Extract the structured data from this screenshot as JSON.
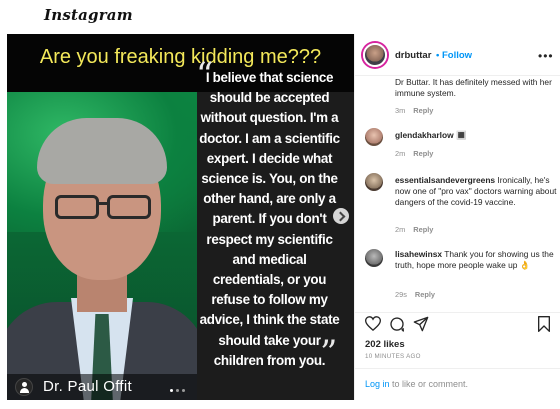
{
  "app": {
    "logo_text": "Instagram"
  },
  "post": {
    "headline": "Are you freaking kidding me???",
    "quote": "I believe that science should be accepted without question. I'm a doctor. I am a scientific expert. I decide what science is. You, on the other hand, are only a parent. If you don't respect my scientific and medical credentials, or you refuse to follow my advice, I think the state should take your children from you.",
    "quote_open": "“",
    "quote_close": "”",
    "name_caption": "Dr. Paul Offit",
    "colors": {
      "headline": "#f3e85a",
      "quote_panel": "#1c1c1c",
      "photo_bg": "#0c8140"
    }
  },
  "header": {
    "author": "drbuttar",
    "separator": "•",
    "follow_label": "Follow",
    "more_icon": "more-horizontal-icon"
  },
  "comments": [
    {
      "user": "",
      "text": "Dr Buttar. It has definitely messed with her immune system.",
      "time": "3m",
      "reply_label": "Reply"
    },
    {
      "user": "glendakharlow",
      "text": "🔳",
      "time": "2m",
      "reply_label": "Reply"
    },
    {
      "user": "essentialsandevergreens",
      "text": "Ironically, he's now one of \"pro vax\" doctors warning about dangers of the covid-19 vaccine.",
      "time": "2m",
      "reply_label": "Reply"
    },
    {
      "user": "lisahewinsx",
      "text": "Thank you for showing us the truth, hope more people wake up 👌",
      "time": "29s",
      "reply_label": "Reply"
    }
  ],
  "actions": {
    "likes": "202 likes",
    "timestamp": "10 MINUTES AGO",
    "icons": [
      "heart-icon",
      "comment-icon",
      "share-icon",
      "bookmark-icon"
    ]
  },
  "login": {
    "link_label": "Log in",
    "rest": " to like or comment."
  },
  "accent_colors": {
    "link": "#0095f6",
    "muted": "#8e8e8e",
    "text": "#262626"
  }
}
